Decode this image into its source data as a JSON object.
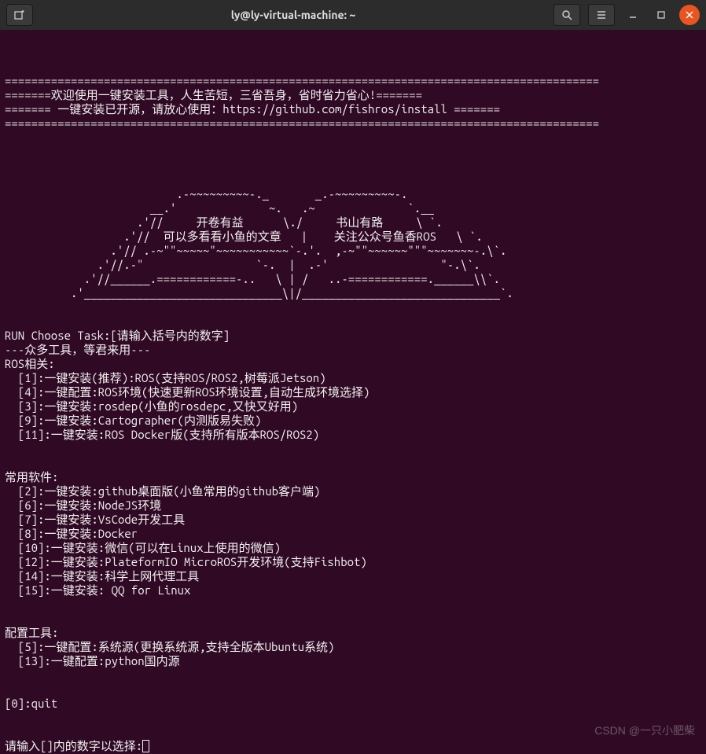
{
  "window": {
    "title": "ly@ly-virtual-machine: ~"
  },
  "terminal": {
    "divider": "==========================================================================================",
    "banner1": "=======欢迎使用一键安装工具，人生苦短，三省吾身，省时省力省心!=======",
    "banner2": "======= 一键安装已开源，请放心使用：https://github.com/fishros/install =======",
    "ascii_art": [
      "                          .-~~~~~~~~~-._       _.-~~~~~~~~~-.",
      "                      __.'              ~.   .~              `.__",
      "                    .'//     开卷有益      \\./     书山有路     \\ `.",
      "                  .'//  可以多看看小鱼的文章   |    关注公众号鱼香ROS   \\ `.",
      "                .'// .-~\"\"~~~~~\"~~~~~~~~~~~`-.'.  ,-~\"\"~~~~~~\"\"\"~~~~~~~-.\\`.",
      "              .'//.-\"                 `-.  |  .-'                 \"-.\\`.",
      "            .'//______.============-..   \\ | /   ..-============.______\\\\`.",
      "          .'______________________________\\|/______________________________`."
    ],
    "prompt_header": "RUN Choose Task:[请输入括号内的数字]",
    "subheader": "---众多工具，等君来用---",
    "section_ros": "ROS相关:",
    "ros_items": [
      "  [1]:一键安装(推荐):ROS(支持ROS/ROS2,树莓派Jetson)",
      "  [4]:一键配置:ROS环境(快速更新ROS环境设置,自动生成环境选择)",
      "  [3]:一键安装:rosdep(小鱼的rosdepc,又快又好用)",
      "  [9]:一键安装:Cartographer(内测版易失败)",
      "  [11]:一键安装:ROS Docker版(支持所有版本ROS/ROS2)"
    ],
    "section_common": "常用软件:",
    "common_items": [
      "  [2]:一键安装:github桌面版(小鱼常用的github客户端)",
      "  [6]:一键安装:NodeJS环境",
      "  [7]:一键安装:VsCode开发工具",
      "  [8]:一键安装:Docker",
      "  [10]:一键安装:微信(可以在Linux上使用的微信)",
      "  [12]:一键安装:PlateformIO MicroROS开发环境(支持Fishbot)",
      "  [14]:一键安装:科学上网代理工具",
      "  [15]:一键安装: QQ for Linux"
    ],
    "section_config": "配置工具:",
    "config_items": [
      "  [5]:一键配置:系统源(更换系统源,支持全版本Ubuntu系统)",
      "  [13]:一键配置:python国内源"
    ],
    "quit_line": "[0]:quit",
    "input_prompt": "请输入[]内的数字以选择:"
  },
  "watermark": "CSDN @一只小肥柴"
}
